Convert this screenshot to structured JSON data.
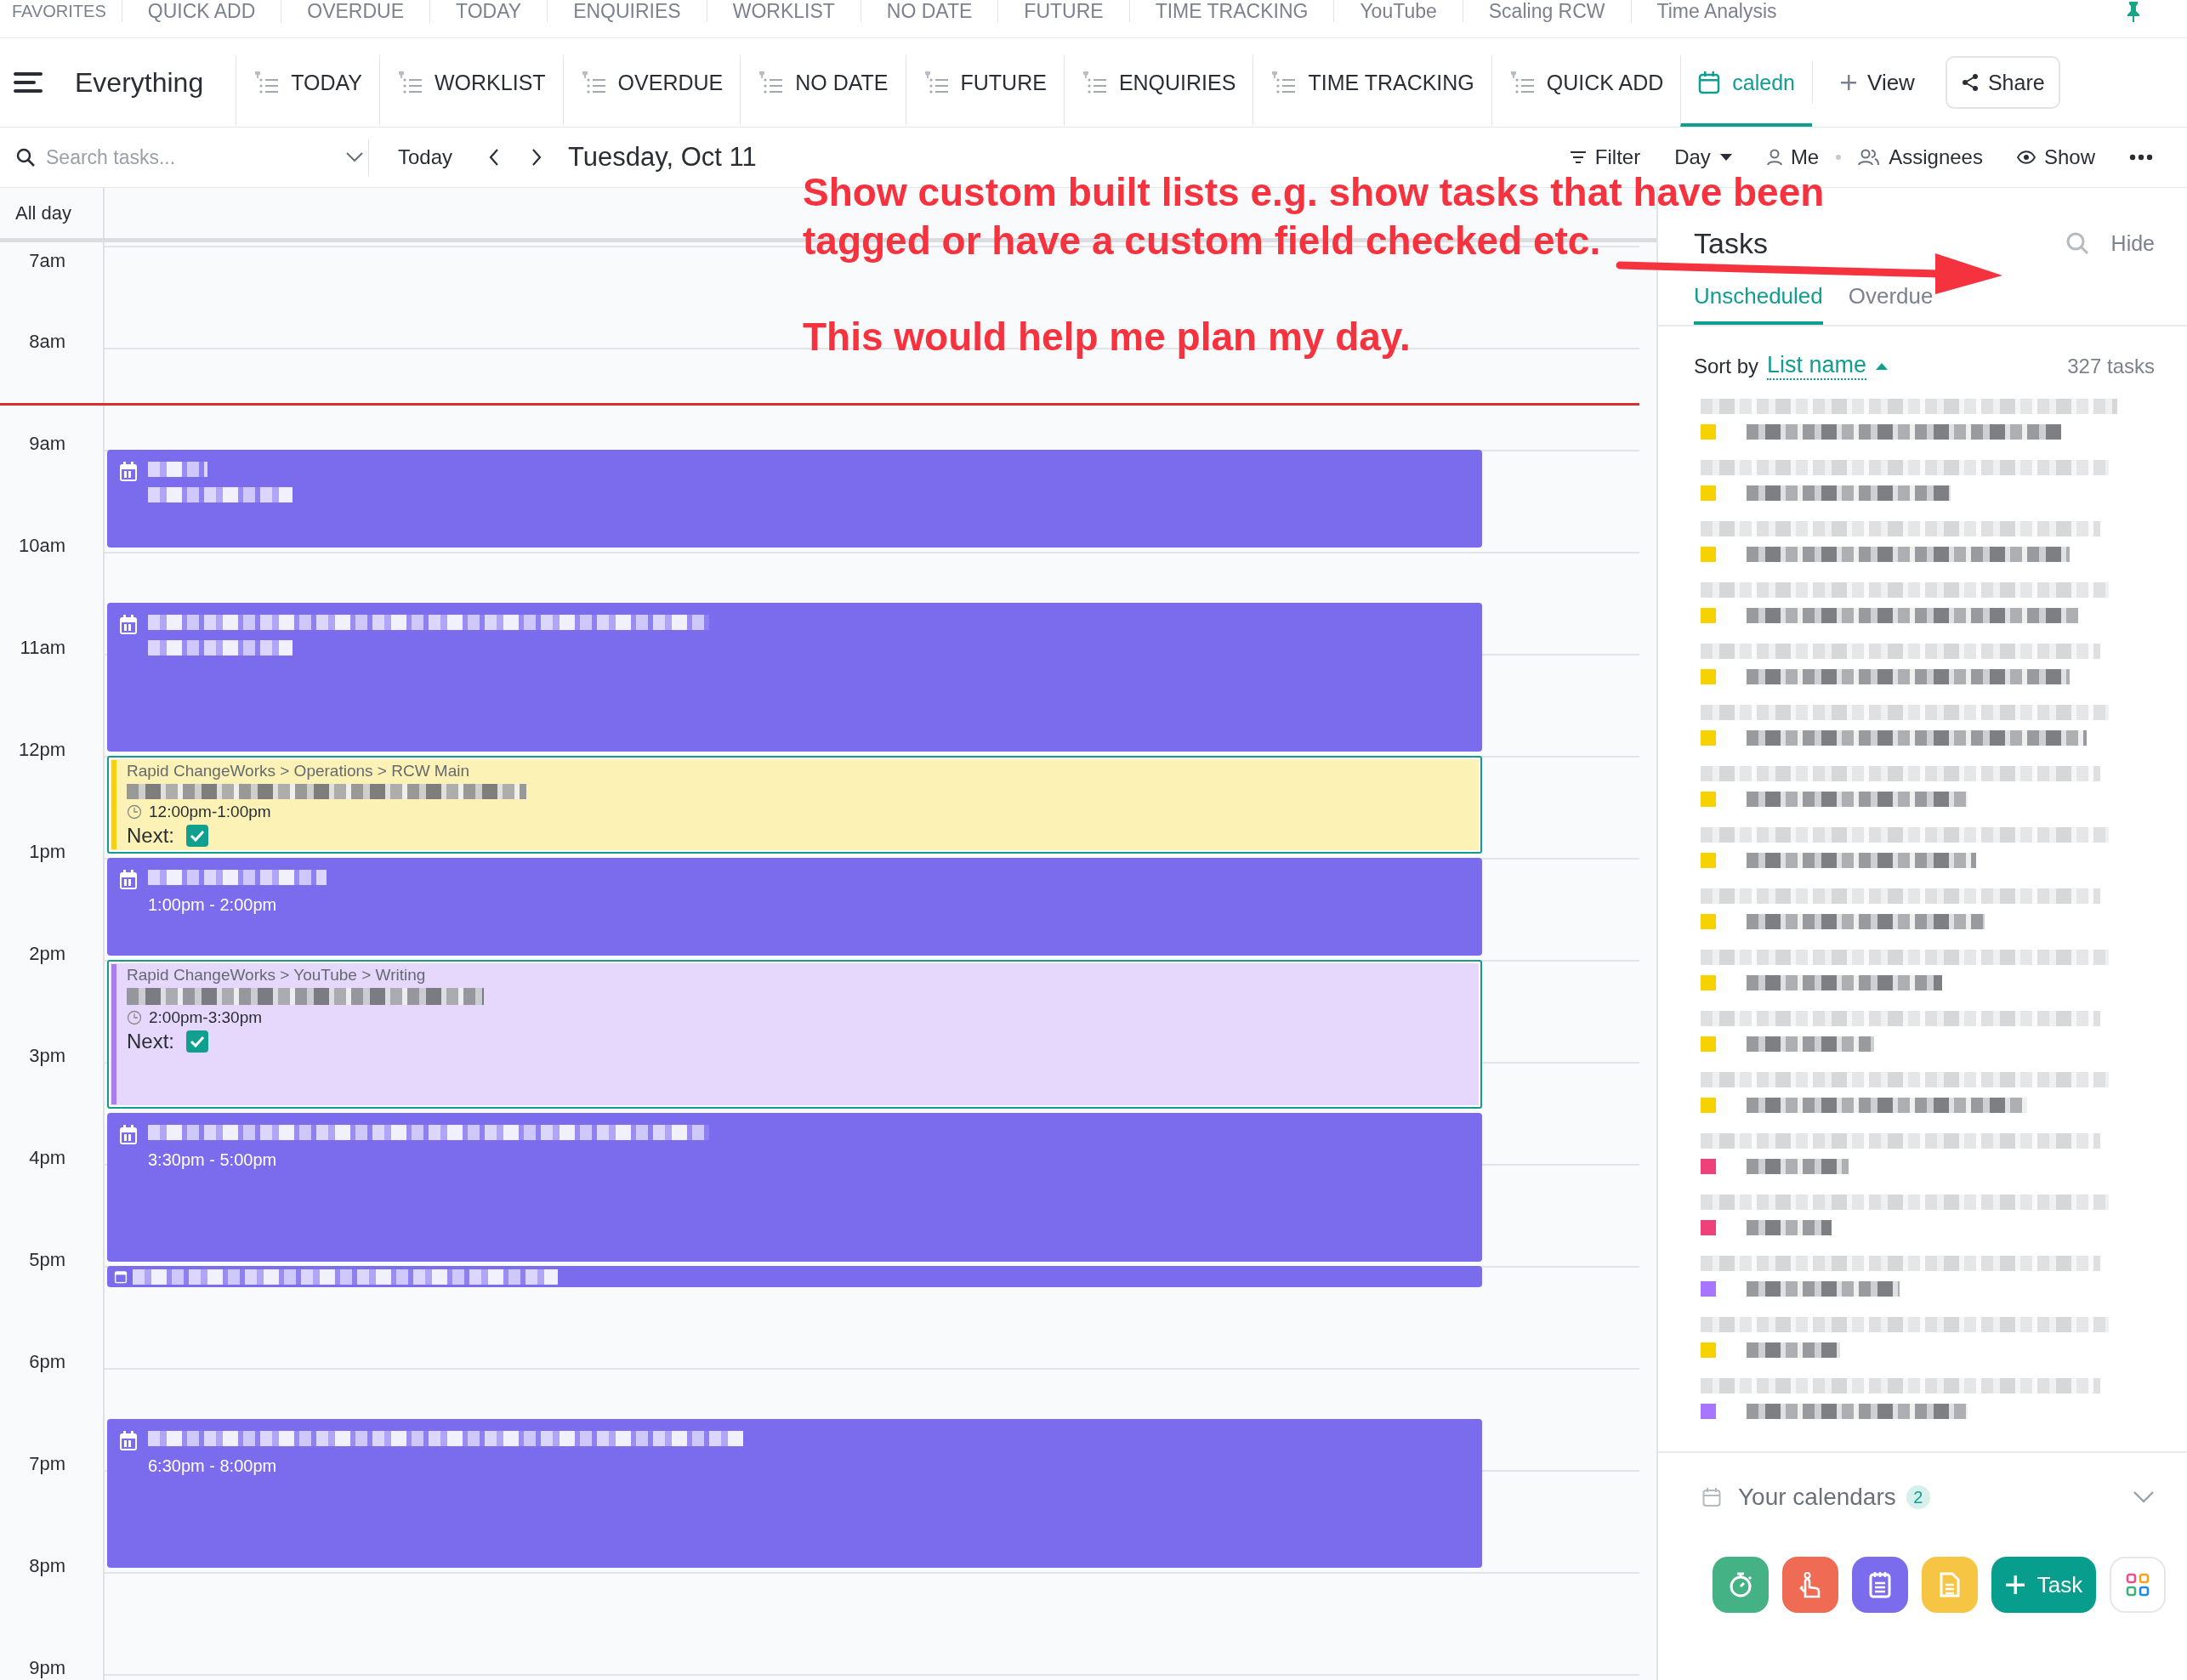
{
  "favorites_bar": {
    "label": "FAVORITES",
    "items": [
      "QUICK ADD",
      "OVERDUE",
      "TODAY",
      "ENQUIRIES",
      "WORKLIST",
      "NO DATE",
      "FUTURE",
      "TIME TRACKING",
      "YouTube",
      "Scaling RCW",
      "Time Analysis"
    ]
  },
  "toolbar": {
    "title": "Everything",
    "views": [
      {
        "label": "TODAY",
        "kind": "list",
        "selected": false
      },
      {
        "label": "WORKLIST",
        "kind": "list",
        "selected": false
      },
      {
        "label": "OVERDUE",
        "kind": "list",
        "selected": false
      },
      {
        "label": "NO DATE",
        "kind": "list",
        "selected": false
      },
      {
        "label": "FUTURE",
        "kind": "list",
        "selected": false
      },
      {
        "label": "ENQUIRIES",
        "kind": "list",
        "selected": false
      },
      {
        "label": "TIME TRACKING",
        "kind": "list",
        "selected": false
      },
      {
        "label": "QUICK ADD",
        "kind": "list",
        "selected": false
      },
      {
        "label": "caledn",
        "kind": "calendar",
        "selected": true
      }
    ],
    "add_view": "View",
    "share": "Share"
  },
  "date_bar": {
    "search_placeholder": "Search tasks...",
    "today": "Today",
    "date": "Tuesday, Oct 11",
    "filter": "Filter",
    "mode": "Day",
    "me": "Me",
    "assignees": "Assignees",
    "show": "Show"
  },
  "calendar": {
    "all_day": "All day",
    "hours": [
      "7am",
      "8am",
      "9am",
      "10am",
      "11am",
      "12pm",
      "1pm",
      "2pm",
      "3pm",
      "4pm",
      "5pm",
      "6pm",
      "7pm",
      "8pm",
      "9pm"
    ],
    "events": [
      {
        "kind": "event"
      },
      {
        "kind": "event"
      },
      {
        "kind": "task",
        "path": "Rapid ChangeWorks > Operations > RCW Main",
        "time": "12:00pm-1:00pm",
        "next_label": "Next:",
        "next_checked": true,
        "color": "#f5d20c"
      },
      {
        "kind": "event",
        "time": "1:00pm - 2:00pm"
      },
      {
        "kind": "task",
        "path": "Rapid ChangeWorks > YouTube > Writing",
        "time": "2:00pm-3:30pm",
        "next_label": "Next:",
        "next_checked": true,
        "color": "#a77cf4"
      },
      {
        "kind": "event",
        "time": "3:30pm - 5:00pm"
      },
      {
        "kind": "compact"
      },
      {
        "kind": "event",
        "time": "6:30pm - 8:00pm"
      }
    ]
  },
  "sidebar": {
    "title": "Tasks",
    "hide": "Hide",
    "tabs": [
      {
        "label": "Unscheduled",
        "selected": true
      },
      {
        "label": "Overdue",
        "selected": false
      }
    ],
    "sort_label": "Sort by",
    "sort_field": "List name",
    "count": "327 tasks",
    "tasks": [
      {
        "color": "#f7d100"
      },
      {
        "color": "#f7d100"
      },
      {
        "color": "#f7d100"
      },
      {
        "color": "#f7d100"
      },
      {
        "color": "#f7d100"
      },
      {
        "color": "#f7d100"
      },
      {
        "color": "#f7d100"
      },
      {
        "color": "#f7d100"
      },
      {
        "color": "#f7d100"
      },
      {
        "color": "#f7d100"
      },
      {
        "color": "#f7d100"
      },
      {
        "color": "#f7d100"
      },
      {
        "color": "#f0407a"
      },
      {
        "color": "#f0407a"
      },
      {
        "color": "#a875ff"
      },
      {
        "color": "#f7d100"
      },
      {
        "color": "#a875ff"
      }
    ],
    "calendars": {
      "label": "Your calendars",
      "count": "2"
    },
    "actions": [
      {
        "kind": "timer"
      },
      {
        "kind": "reminder"
      },
      {
        "kind": "notepad"
      },
      {
        "kind": "doc"
      },
      {
        "kind": "task",
        "label": "Task"
      },
      {
        "kind": "apps"
      }
    ]
  },
  "annotation": {
    "lines": [
      "Show custom built lists e.g. show tasks that have been",
      "tagged or have a custom field checked etc."
    ],
    "note": "This would help me plan my day."
  }
}
